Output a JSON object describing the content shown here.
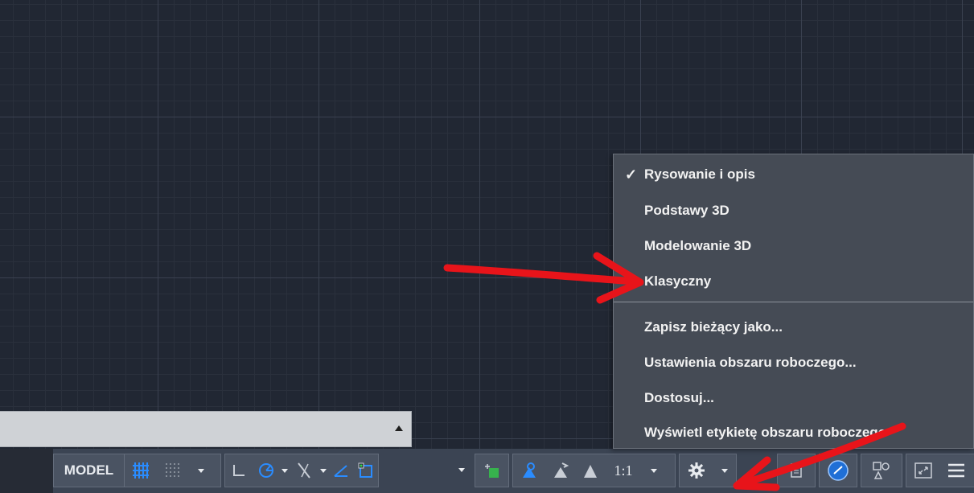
{
  "statusbar": {
    "model_label": "MODEL",
    "scale_label": "1:1"
  },
  "menu": {
    "items": [
      {
        "label": "Rysowanie i opis",
        "checked": true
      },
      {
        "label": "Podstawy 3D"
      },
      {
        "label": "Modelowanie 3D"
      },
      {
        "label": "Klasyczny"
      },
      {
        "label": "Zapisz bieżący jako..."
      },
      {
        "label": "Ustawienia obszaru roboczego..."
      },
      {
        "label": "Dostosuj..."
      },
      {
        "label": "Wyświetl etykietę obszaru roboczego"
      }
    ],
    "check_glyph": "✓"
  },
  "colors": {
    "canvas_bg": "#212733",
    "menu_bg": "#454b55",
    "accent_blue": "#2a8cff",
    "annotation_red": "#e8141a",
    "statusbar_bg": "#3b4453"
  },
  "icons": [
    "grid-display-icon",
    "snap-mode-icon",
    "ortho-mode-icon",
    "polar-tracking-icon",
    "isodraft-icon",
    "object-snap-tracking-icon",
    "object-snap-icon",
    "transparency-icon",
    "annotation-visibility-icon",
    "auto-scale-icon",
    "annotation-scale-icon",
    "workspace-gear-icon",
    "annotation-monitor-icon",
    "isolate-objects-icon",
    "hardware-acceleration-icon",
    "clean-screen-icon",
    "customization-icon"
  ]
}
